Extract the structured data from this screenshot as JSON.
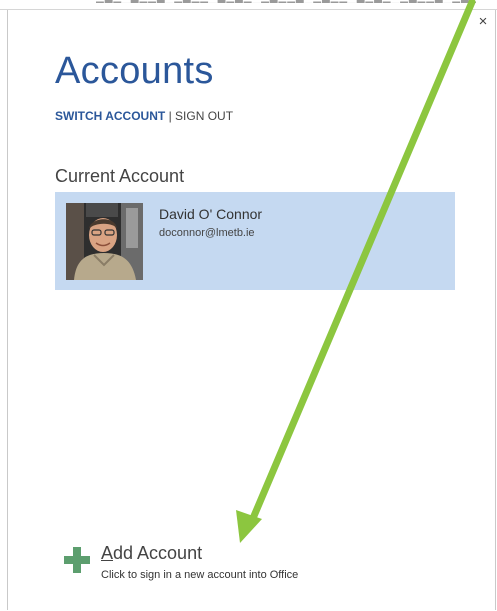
{
  "dialog": {
    "close_glyph": "×",
    "title": "Accounts",
    "links": {
      "switch_account": "SWITCH ACCOUNT",
      "separator": "|",
      "sign_out": "SIGN OUT"
    }
  },
  "current_account": {
    "heading": "Current Account",
    "name": "David O' Connor",
    "email": "doconnor@lmetb.ie",
    "avatar_icon": "person-photo"
  },
  "add_account": {
    "mnemonic": "A",
    "label_rest": "dd Account",
    "description": "Click to sign in a new account into Office",
    "icon": "plus-icon",
    "icon_color": "#5c9e6e"
  },
  "colors": {
    "accent": "#2b579a",
    "selected_card": "#c5d9f1",
    "annotation_arrow": "#8cc63f"
  }
}
